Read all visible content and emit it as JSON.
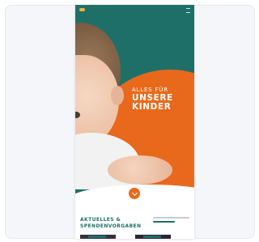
{
  "hero": {
    "headline_line1": "ALLES FÜR",
    "headline_line2": "UNSERE",
    "headline_line3": "KINDER"
  },
  "section": {
    "title_line1": "AKTUELLES &",
    "title_line2": "SPENDENVORGABEN"
  },
  "colors": {
    "teal": "#1f6f69",
    "orange": "#e8691b",
    "background": "#f5f6f9"
  },
  "icons": [
    "logo-icon",
    "menu-icon",
    "chevron-down-icon"
  ]
}
